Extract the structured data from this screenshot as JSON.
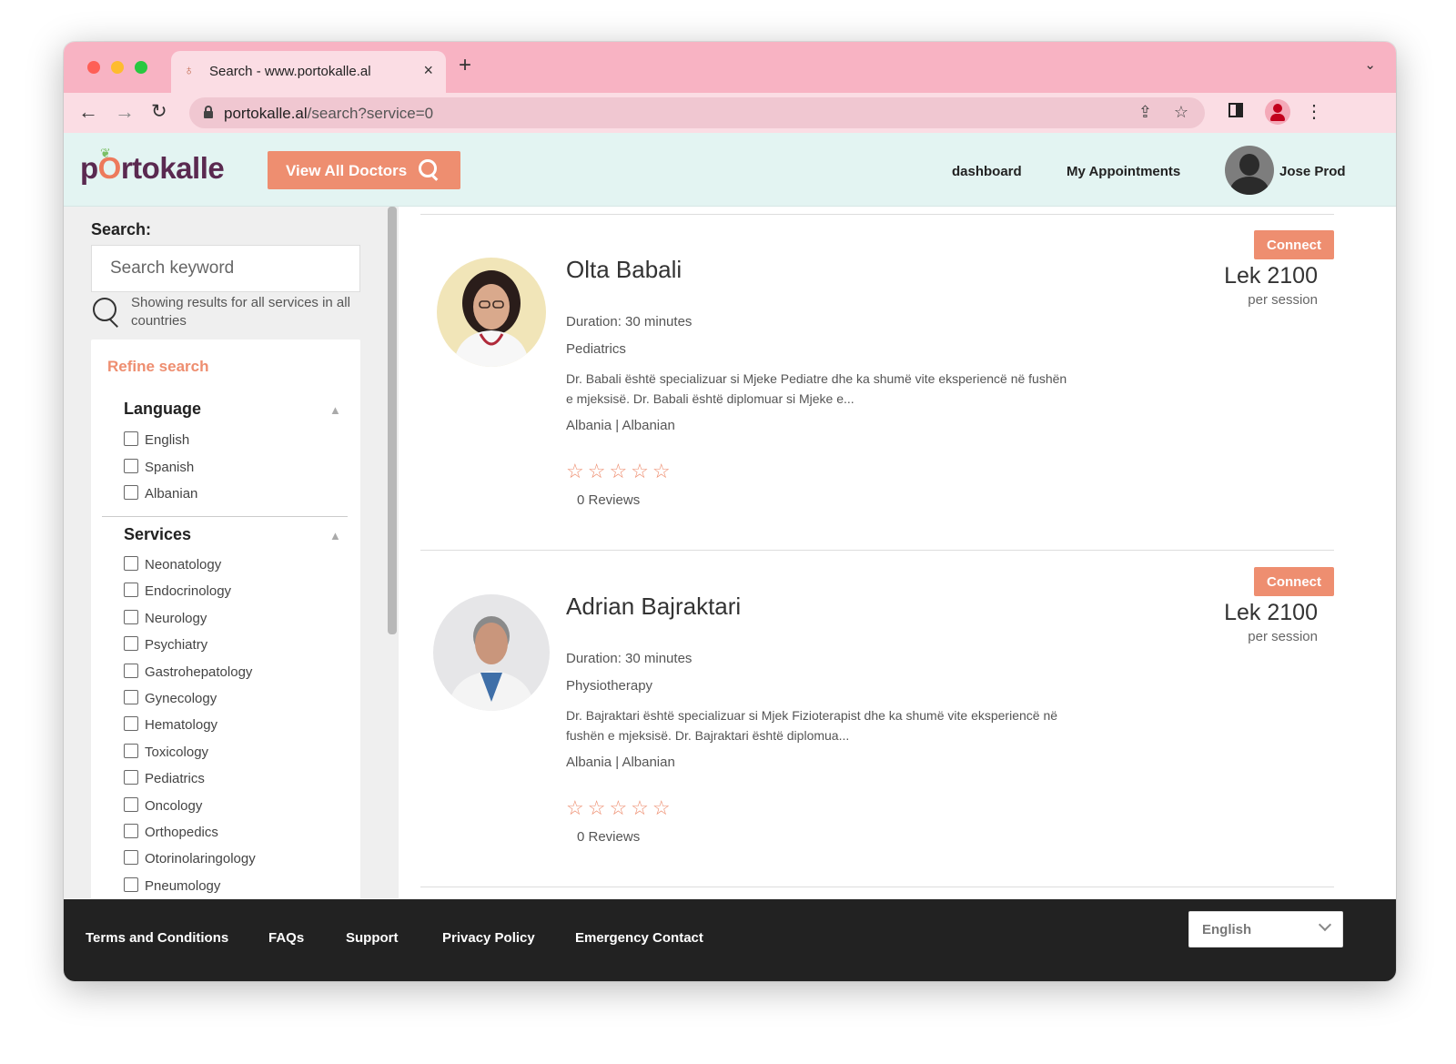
{
  "browser": {
    "tab_title": "Search - www.portokalle.al",
    "url_domain": "portokalle.al",
    "url_path": "/search?service=0"
  },
  "header": {
    "logo_pre": "p",
    "logo_o": "O",
    "logo_post": "rtokalle",
    "view_all_label": "View All Doctors",
    "nav_dashboard": "dashboard",
    "nav_appointments": "My Appointments",
    "user_name": "Jose Prod"
  },
  "sidebar": {
    "search_label": "Search:",
    "search_placeholder": "Search keyword",
    "results_text": "Showing results for all services in all countries",
    "refine_title": "Refine search",
    "language": {
      "title": "Language",
      "options": [
        "English",
        "Spanish",
        "Albanian"
      ]
    },
    "services": {
      "title": "Services",
      "options": [
        "Neonatology",
        "Endocrinology",
        "Neurology",
        "Psychiatry",
        "Gastrohepatology",
        "Gynecology",
        "Hematology",
        "Toxicology",
        "Pediatrics",
        "Oncology",
        "Orthopedics",
        "Otorinolaringology",
        "Pneumology"
      ]
    }
  },
  "doctors": [
    {
      "name": "Olta Babali",
      "duration": "Duration: 30 minutes",
      "specialty": "Pediatrics",
      "description": "Dr. Babali është specializuar si Mjeke Pediatre dhe ka shumë vite eksperiencë në fushën e mjeksisë. Dr. Babali është diplomuar si Mjeke e...",
      "location": "Albania | Albanian",
      "stars": "☆☆☆☆☆",
      "rating": 0,
      "reviews": "0 Reviews",
      "connect_label": "Connect",
      "price": "Lek 2100",
      "price_unit": "per session"
    },
    {
      "name": "Adrian Bajraktari",
      "duration": "Duration: 30 minutes",
      "specialty": "Physiotherapy",
      "description": "Dr. Bajraktari është specializuar si Mjek Fizioterapist dhe ka shumë vite eksperiencë në fushën e mjeksisë. Dr. Bajraktari është diplomua...",
      "location": "Albania | Albanian",
      "stars": "☆☆☆☆☆",
      "rating": 0,
      "reviews": "0 Reviews",
      "connect_label": "Connect",
      "price": "Lek 2100",
      "price_unit": "per session"
    }
  ],
  "footer": {
    "links": [
      "Terms and Conditions",
      "FAQs",
      "Support",
      "Privacy Policy",
      "Emergency Contact"
    ],
    "language_value": "English"
  },
  "colors": {
    "accent": "#ee8e70",
    "tab_bar": "#f8b3c3",
    "header_bg": "#e3f4f2",
    "footer_bg": "#222222"
  }
}
